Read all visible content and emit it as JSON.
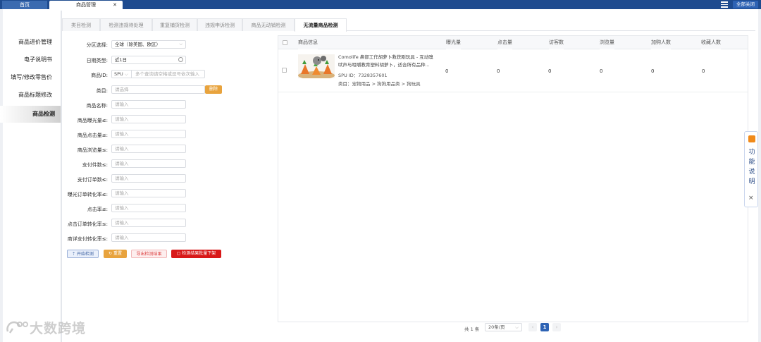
{
  "tabs": {
    "home": "首页",
    "goods": "商品管理",
    "close_all": "全部关闭"
  },
  "nav": [
    "商品进价管理",
    "电子说明书",
    "填写/修改零售价",
    "商品标题修改",
    "商品检测"
  ],
  "subtabs": [
    "类目检测",
    "检测违规待处理",
    "重复铺货检测",
    "违规申诉检测",
    "商品无动销检测",
    "无流量商品检测"
  ],
  "form": {
    "region": {
      "label": "分区选择:",
      "value": "全球（除美国、欧区）"
    },
    "date_type": {
      "label": "日期类型:",
      "value": "近1日"
    },
    "product_id": {
      "label": "商品ID:",
      "type": "SPU",
      "placeholder": "多个查询请空格或逗号依次输入"
    },
    "category": {
      "label": "类目:",
      "placeholder": "请选择",
      "delete": "删除"
    },
    "fields": [
      {
        "label": "商品名称:",
        "placeholder": "请输入"
      },
      {
        "label": "商品曝光量≤:",
        "placeholder": "请输入"
      },
      {
        "label": "商品点击量≤:",
        "placeholder": "请输入"
      },
      {
        "label": "商品浏览量≤:",
        "placeholder": "请输入"
      },
      {
        "label": "支付件数≤:",
        "placeholder": "请输入"
      },
      {
        "label": "支付订单数≤:",
        "placeholder": "请输入"
      },
      {
        "label": "曝光订单转化率≤:",
        "placeholder": "请输入"
      },
      {
        "label": "点击率≤:",
        "placeholder": "请输入"
      },
      {
        "label": "点击订单转化率≤:",
        "placeholder": "请输入"
      },
      {
        "label": "商详支付转化率≤:",
        "placeholder": "请输入"
      }
    ],
    "buttons": {
      "start": "开始检测",
      "reset": "重置",
      "export": "导出检测结果",
      "batch_off": "检测结果批量下架"
    }
  },
  "table": {
    "headers": [
      "商品信息",
      "曝光量",
      "点击量",
      "访客数",
      "浏览量",
      "加购人数",
      "收藏人数"
    ],
    "rows": [
      {
        "title_line1": "Comolife 鼻部工作胡萝卜救获刚玩具 - 互动嗅",
        "title_line2": "吠声与咀嚼教育塑料胡萝卜，适合所有品种...",
        "spu": "SPU ID：7328357601",
        "category": "类目：宠物用品 > 狗狗用品类 > 狗玩具",
        "values": [
          "0",
          "0",
          "0",
          "0",
          "0",
          "0"
        ]
      }
    ]
  },
  "pagination": {
    "total": "共 1 条",
    "page_size": "20条/页",
    "current": "1",
    "prev": "‹",
    "next": "›"
  },
  "help": {
    "text": "功能说明",
    "close": "×"
  },
  "watermark": "大数跨境",
  "colors": {
    "topbar": "#1e4b8f",
    "accent": "#2e63b4",
    "orange": "#e8a33d",
    "danger": "#d81818"
  }
}
